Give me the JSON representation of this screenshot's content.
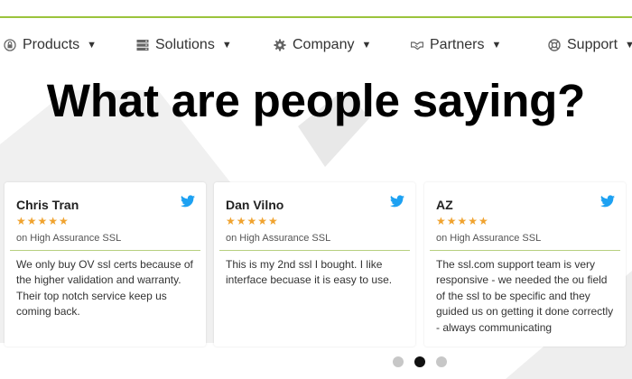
{
  "nav": {
    "items": [
      {
        "label": "Products",
        "icon": "lock-icon"
      },
      {
        "label": "Solutions",
        "icon": "server-icon"
      },
      {
        "label": "Company",
        "icon": "gear-icon"
      },
      {
        "label": "Partners",
        "icon": "handshake-icon"
      },
      {
        "label": "Support",
        "icon": "lifebuoy-icon"
      }
    ]
  },
  "headline": "What are people saying?",
  "reviews": [
    {
      "name": "Chris Tran",
      "stars": "★★★★★",
      "product": "on High Assurance SSL",
      "text": "We only buy OV ssl certs because of the higher validation and warranty. Their top notch service keep us coming back."
    },
    {
      "name": "Dan Vilno",
      "stars": "★★★★★",
      "product": "on High Assurance SSL",
      "text": "This is my 2nd ssl I bought. I like interface becuase it is easy to use."
    },
    {
      "name": "AZ",
      "stars": "★★★★★",
      "product": "on High Assurance SSL",
      "text": "The ssl.com support team is very responsive - we needed the ou field of the ssl to be specific and they guided us on getting it done correctly - always communicating"
    }
  ],
  "colors": {
    "accent": "#9bc43c",
    "star": "#f0a32f",
    "twitter": "#1da1f2"
  }
}
